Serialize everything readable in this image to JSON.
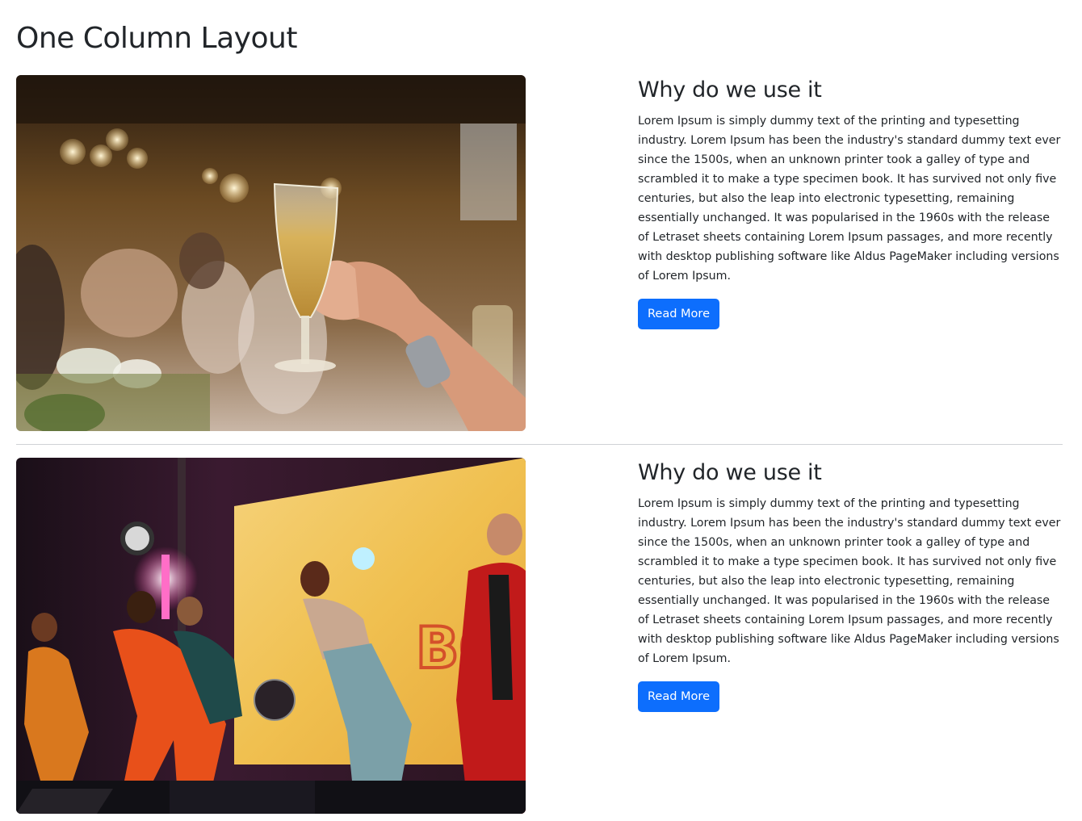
{
  "page": {
    "title": "One Column Layout"
  },
  "cards": [
    {
      "heading": "Why do we use it",
      "body": "Lorem Ipsum is simply dummy text of the printing and typesetting industry. Lorem Ipsum has been the industry's standard dummy text ever since the 1500s, when an unknown printer took a galley of type and scrambled it to make a type specimen book. It has survived not only five centuries, but also the leap into electronic typesetting, remaining essentially unchanged. It was popularised in the 1960s with the release of Letraset sheets containing Lorem Ipsum passages, and more recently with desktop publishing software like Aldus PageMaker including versions of Lorem Ipsum.",
      "button_label": "Read More",
      "image": "champagne-toast-photo"
    },
    {
      "heading": "Why do we use it",
      "body": "Lorem Ipsum is simply dummy text of the printing and typesetting industry. Lorem Ipsum has been the industry's standard dummy text ever since the 1500s, when an unknown printer took a galley of type and scrambled it to make a type specimen book. It has survived not only five centuries, but also the leap into electronic typesetting, remaining essentially unchanged. It was popularised in the 1960s with the release of Letraset sheets containing Lorem Ipsum passages, and more recently with desktop publishing software like Aldus PageMaker including versions of Lorem Ipsum.",
      "button_label": "Read More",
      "image": "concert-band-photo"
    }
  ],
  "colors": {
    "primary_button": "#0d6efd",
    "text": "#212529",
    "divider": "#cfd2d6"
  }
}
